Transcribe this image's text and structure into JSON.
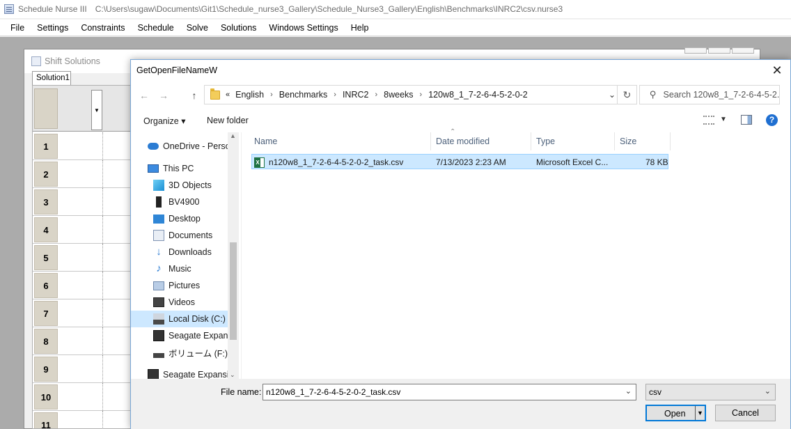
{
  "app": {
    "title": "Schedule Nurse III",
    "path": "C:\\Users\\sugaw\\Documents\\Git1\\Schedule_nurse3_Gallery\\Schedule_Nurse3_Gallery\\English\\Benchmarks\\INRC2\\csv.nurse3"
  },
  "menu": [
    "File",
    "Settings",
    "Constraints",
    "Schedule",
    "Solve",
    "Solutions",
    "Windows Settings",
    "Help"
  ],
  "child_window": {
    "title": "Shift Solutions",
    "tab": "Solution1",
    "row_numbers": [
      "1",
      "2",
      "3",
      "4",
      "5",
      "6",
      "7",
      "8",
      "9",
      "10",
      "11"
    ]
  },
  "dialog": {
    "title": "GetOpenFileNameW",
    "close": "✕",
    "breadcrumbs": [
      "English",
      "Benchmarks",
      "INRC2",
      "8weeks",
      "120w8_1_7-2-6-4-5-2-0-2"
    ],
    "breadcrumb_prefix": "«",
    "search_placeholder": "Search 120w8_1_7-2-6-4-5-2...",
    "organize": "Organize ▾",
    "new_folder": "New folder",
    "nav": [
      {
        "label": "OneDrive - Persor",
        "icon": "onedrive-icon"
      },
      {
        "label": "This PC",
        "icon": "computer-icon"
      },
      {
        "label": "3D Objects",
        "icon": "cube-icon"
      },
      {
        "label": "BV4900",
        "icon": "phone-icon"
      },
      {
        "label": "Desktop",
        "icon": "desktop-icon"
      },
      {
        "label": "Documents",
        "icon": "document-icon"
      },
      {
        "label": "Downloads",
        "icon": "download-icon"
      },
      {
        "label": "Music",
        "icon": "music-icon"
      },
      {
        "label": "Pictures",
        "icon": "pictures-icon"
      },
      {
        "label": "Videos",
        "icon": "video-icon"
      },
      {
        "label": "Local Disk (C:)",
        "icon": "disk-icon"
      },
      {
        "label": "Seagate Expansio",
        "icon": "external-drive-icon"
      },
      {
        "label": "ボリューム (F:)",
        "icon": "drive-icon"
      },
      {
        "label": "Seagate Expansion",
        "icon": "external-drive-icon"
      }
    ],
    "columns": [
      "Name",
      "Date modified",
      "Type",
      "Size"
    ],
    "files": [
      {
        "name": "n120w8_1_7-2-6-4-5-2-0-2_task.csv",
        "date": "7/13/2023 2:23 AM",
        "type": "Microsoft Excel C...",
        "size": "78 KB"
      }
    ],
    "file_name_label": "File name:",
    "file_name_value": "n120w8_1_7-2-6-4-5-2-0-2_task.csv",
    "file_type": "csv",
    "open_label": "Open",
    "cancel_label": "Cancel"
  },
  "colors": {
    "selection": "#cce8ff",
    "accent": "#0078d7",
    "grid_header": "#d9d4c7"
  }
}
